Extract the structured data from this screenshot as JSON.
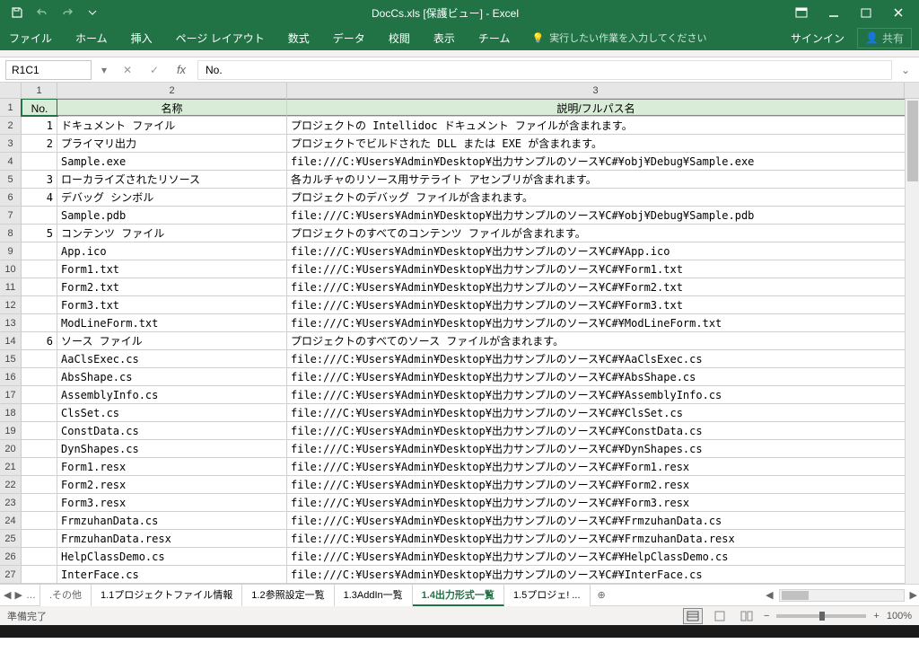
{
  "title": "DocCs.xls  [保護ビュー] - Excel",
  "ribbon": {
    "file": "ファイル",
    "home": "ホーム",
    "insert": "挿入",
    "layout": "ページ レイアウト",
    "formulas": "数式",
    "data": "データ",
    "review": "校閲",
    "view": "表示",
    "team": "チーム",
    "tellme": "実行したい作業を入力してください",
    "signin": "サインイン",
    "share": "共有"
  },
  "nameBox": "R1C1",
  "formula": "No.",
  "colHeaders": [
    "1",
    "2",
    "3"
  ],
  "headerRow": {
    "c1": "No.",
    "c2": "名称",
    "c3": "説明/フルパス名"
  },
  "rows": [
    {
      "r": 2,
      "no": "1",
      "name": "ドキュメント ファイル",
      "desc": "プロジェクトの Intellidoc ドキュメント ファイルが含まれます。"
    },
    {
      "r": 3,
      "no": "2",
      "name": "プライマリ出力",
      "desc": "プロジェクトでビルドされた DLL または EXE が含まれます。"
    },
    {
      "r": 4,
      "no": "",
      "name": "Sample.exe",
      "desc": "file:///C:¥Users¥Admin¥Desktop¥出力サンプルのソース¥C#¥obj¥Debug¥Sample.exe"
    },
    {
      "r": 5,
      "no": "3",
      "name": "ローカライズされたリソース",
      "desc": "各カルチャのリソース用サテライト アセンブリが含まれます。"
    },
    {
      "r": 6,
      "no": "4",
      "name": "デバッグ シンボル",
      "desc": "プロジェクトのデバッグ ファイルが含まれます。"
    },
    {
      "r": 7,
      "no": "",
      "name": "Sample.pdb",
      "desc": "file:///C:¥Users¥Admin¥Desktop¥出力サンプルのソース¥C#¥obj¥Debug¥Sample.pdb"
    },
    {
      "r": 8,
      "no": "5",
      "name": "コンテンツ ファイル",
      "desc": "プロジェクトのすべてのコンテンツ ファイルが含まれます。"
    },
    {
      "r": 9,
      "no": "",
      "name": "App.ico",
      "desc": "file:///C:¥Users¥Admin¥Desktop¥出力サンプルのソース¥C#¥App.ico"
    },
    {
      "r": 10,
      "no": "",
      "name": "Form1.txt",
      "desc": "file:///C:¥Users¥Admin¥Desktop¥出力サンプルのソース¥C#¥Form1.txt"
    },
    {
      "r": 11,
      "no": "",
      "name": "Form2.txt",
      "desc": "file:///C:¥Users¥Admin¥Desktop¥出力サンプルのソース¥C#¥Form2.txt"
    },
    {
      "r": 12,
      "no": "",
      "name": "Form3.txt",
      "desc": "file:///C:¥Users¥Admin¥Desktop¥出力サンプルのソース¥C#¥Form3.txt"
    },
    {
      "r": 13,
      "no": "",
      "name": "ModLineForm.txt",
      "desc": "file:///C:¥Users¥Admin¥Desktop¥出力サンプルのソース¥C#¥ModLineForm.txt"
    },
    {
      "r": 14,
      "no": "6",
      "name": "ソース ファイル",
      "desc": "プロジェクトのすべてのソース ファイルが含まれます。"
    },
    {
      "r": 15,
      "no": "",
      "name": "AaClsExec.cs",
      "desc": "file:///C:¥Users¥Admin¥Desktop¥出力サンプルのソース¥C#¥AaClsExec.cs"
    },
    {
      "r": 16,
      "no": "",
      "name": "AbsShape.cs",
      "desc": "file:///C:¥Users¥Admin¥Desktop¥出力サンプルのソース¥C#¥AbsShape.cs"
    },
    {
      "r": 17,
      "no": "",
      "name": "AssemblyInfo.cs",
      "desc": "file:///C:¥Users¥Admin¥Desktop¥出力サンプルのソース¥C#¥AssemblyInfo.cs"
    },
    {
      "r": 18,
      "no": "",
      "name": "ClsSet.cs",
      "desc": "file:///C:¥Users¥Admin¥Desktop¥出力サンプルのソース¥C#¥ClsSet.cs"
    },
    {
      "r": 19,
      "no": "",
      "name": "ConstData.cs",
      "desc": "file:///C:¥Users¥Admin¥Desktop¥出力サンプルのソース¥C#¥ConstData.cs"
    },
    {
      "r": 20,
      "no": "",
      "name": "DynShapes.cs",
      "desc": "file:///C:¥Users¥Admin¥Desktop¥出力サンプルのソース¥C#¥DynShapes.cs"
    },
    {
      "r": 21,
      "no": "",
      "name": "Form1.resx",
      "desc": "file:///C:¥Users¥Admin¥Desktop¥出力サンプルのソース¥C#¥Form1.resx"
    },
    {
      "r": 22,
      "no": "",
      "name": "Form2.resx",
      "desc": "file:///C:¥Users¥Admin¥Desktop¥出力サンプルのソース¥C#¥Form2.resx"
    },
    {
      "r": 23,
      "no": "",
      "name": "Form3.resx",
      "desc": "file:///C:¥Users¥Admin¥Desktop¥出力サンプルのソース¥C#¥Form3.resx"
    },
    {
      "r": 24,
      "no": "",
      "name": "FrmzuhanData.cs",
      "desc": "file:///C:¥Users¥Admin¥Desktop¥出力サンプルのソース¥C#¥FrmzuhanData.cs"
    },
    {
      "r": 25,
      "no": "",
      "name": "FrmzuhanData.resx",
      "desc": "file:///C:¥Users¥Admin¥Desktop¥出力サンプルのソース¥C#¥FrmzuhanData.resx"
    },
    {
      "r": 26,
      "no": "",
      "name": "HelpClassDemo.cs",
      "desc": "file:///C:¥Users¥Admin¥Desktop¥出力サンプルのソース¥C#¥HelpClassDemo.cs"
    },
    {
      "r": 27,
      "no": "",
      "name": "InterFace.cs",
      "desc": "file:///C:¥Users¥Admin¥Desktop¥出力サンプルのソース¥C#¥InterFace.cs"
    }
  ],
  "tabs": [
    {
      "id": "other",
      "label": ".その他",
      "active": false,
      "dim": true
    },
    {
      "id": "t1",
      "label": "1.1プロジェクトファイル情報",
      "active": false
    },
    {
      "id": "t2",
      "label": "1.2参照設定一覧",
      "active": false
    },
    {
      "id": "t3",
      "label": "1.3AddIn一覧",
      "active": false
    },
    {
      "id": "t4",
      "label": "1.4出力形式一覧",
      "active": true
    },
    {
      "id": "t5",
      "label": "1.5プロジェ! ...",
      "active": false
    }
  ],
  "status": {
    "ready": "準備完了",
    "zoom": "100%"
  }
}
